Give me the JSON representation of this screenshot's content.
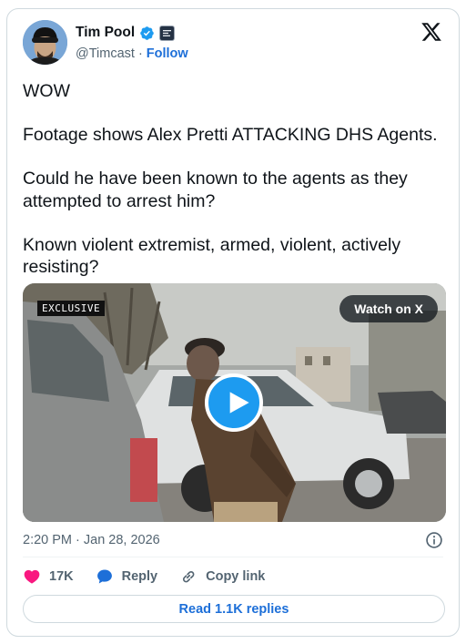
{
  "author": {
    "name": "Tim Pool",
    "handle": "@Timcast",
    "separator": "·",
    "follow_label": "Follow",
    "affiliate_badge_text": "TIMCAST",
    "avatar_icon": "avatar-photo"
  },
  "platform_icon": "x-logo-icon",
  "tweet": {
    "paragraphs": [
      "WOW",
      "Footage shows Alex Pretti ATTACKING DHS Agents.",
      "Could he have been known to the agents as they attempted to arrest him?",
      "Known violent extremist, armed, violent, actively resisting?"
    ]
  },
  "media": {
    "badge": "EXCLUSIVE",
    "watch_label": "Watch on X",
    "play_icon": "play-icon"
  },
  "timestamp": "2:20 PM · Jan 28, 2026",
  "actions": {
    "likes": "17K",
    "reply_label": "Reply",
    "copy_link_label": "Copy link"
  },
  "read_replies_label": "Read 1.1K replies",
  "colors": {
    "accent": "#1d9bf0",
    "link": "#1d6fd8",
    "like_heart": "#f91880",
    "secondary_text": "#536471",
    "border": "#cfd9de"
  }
}
